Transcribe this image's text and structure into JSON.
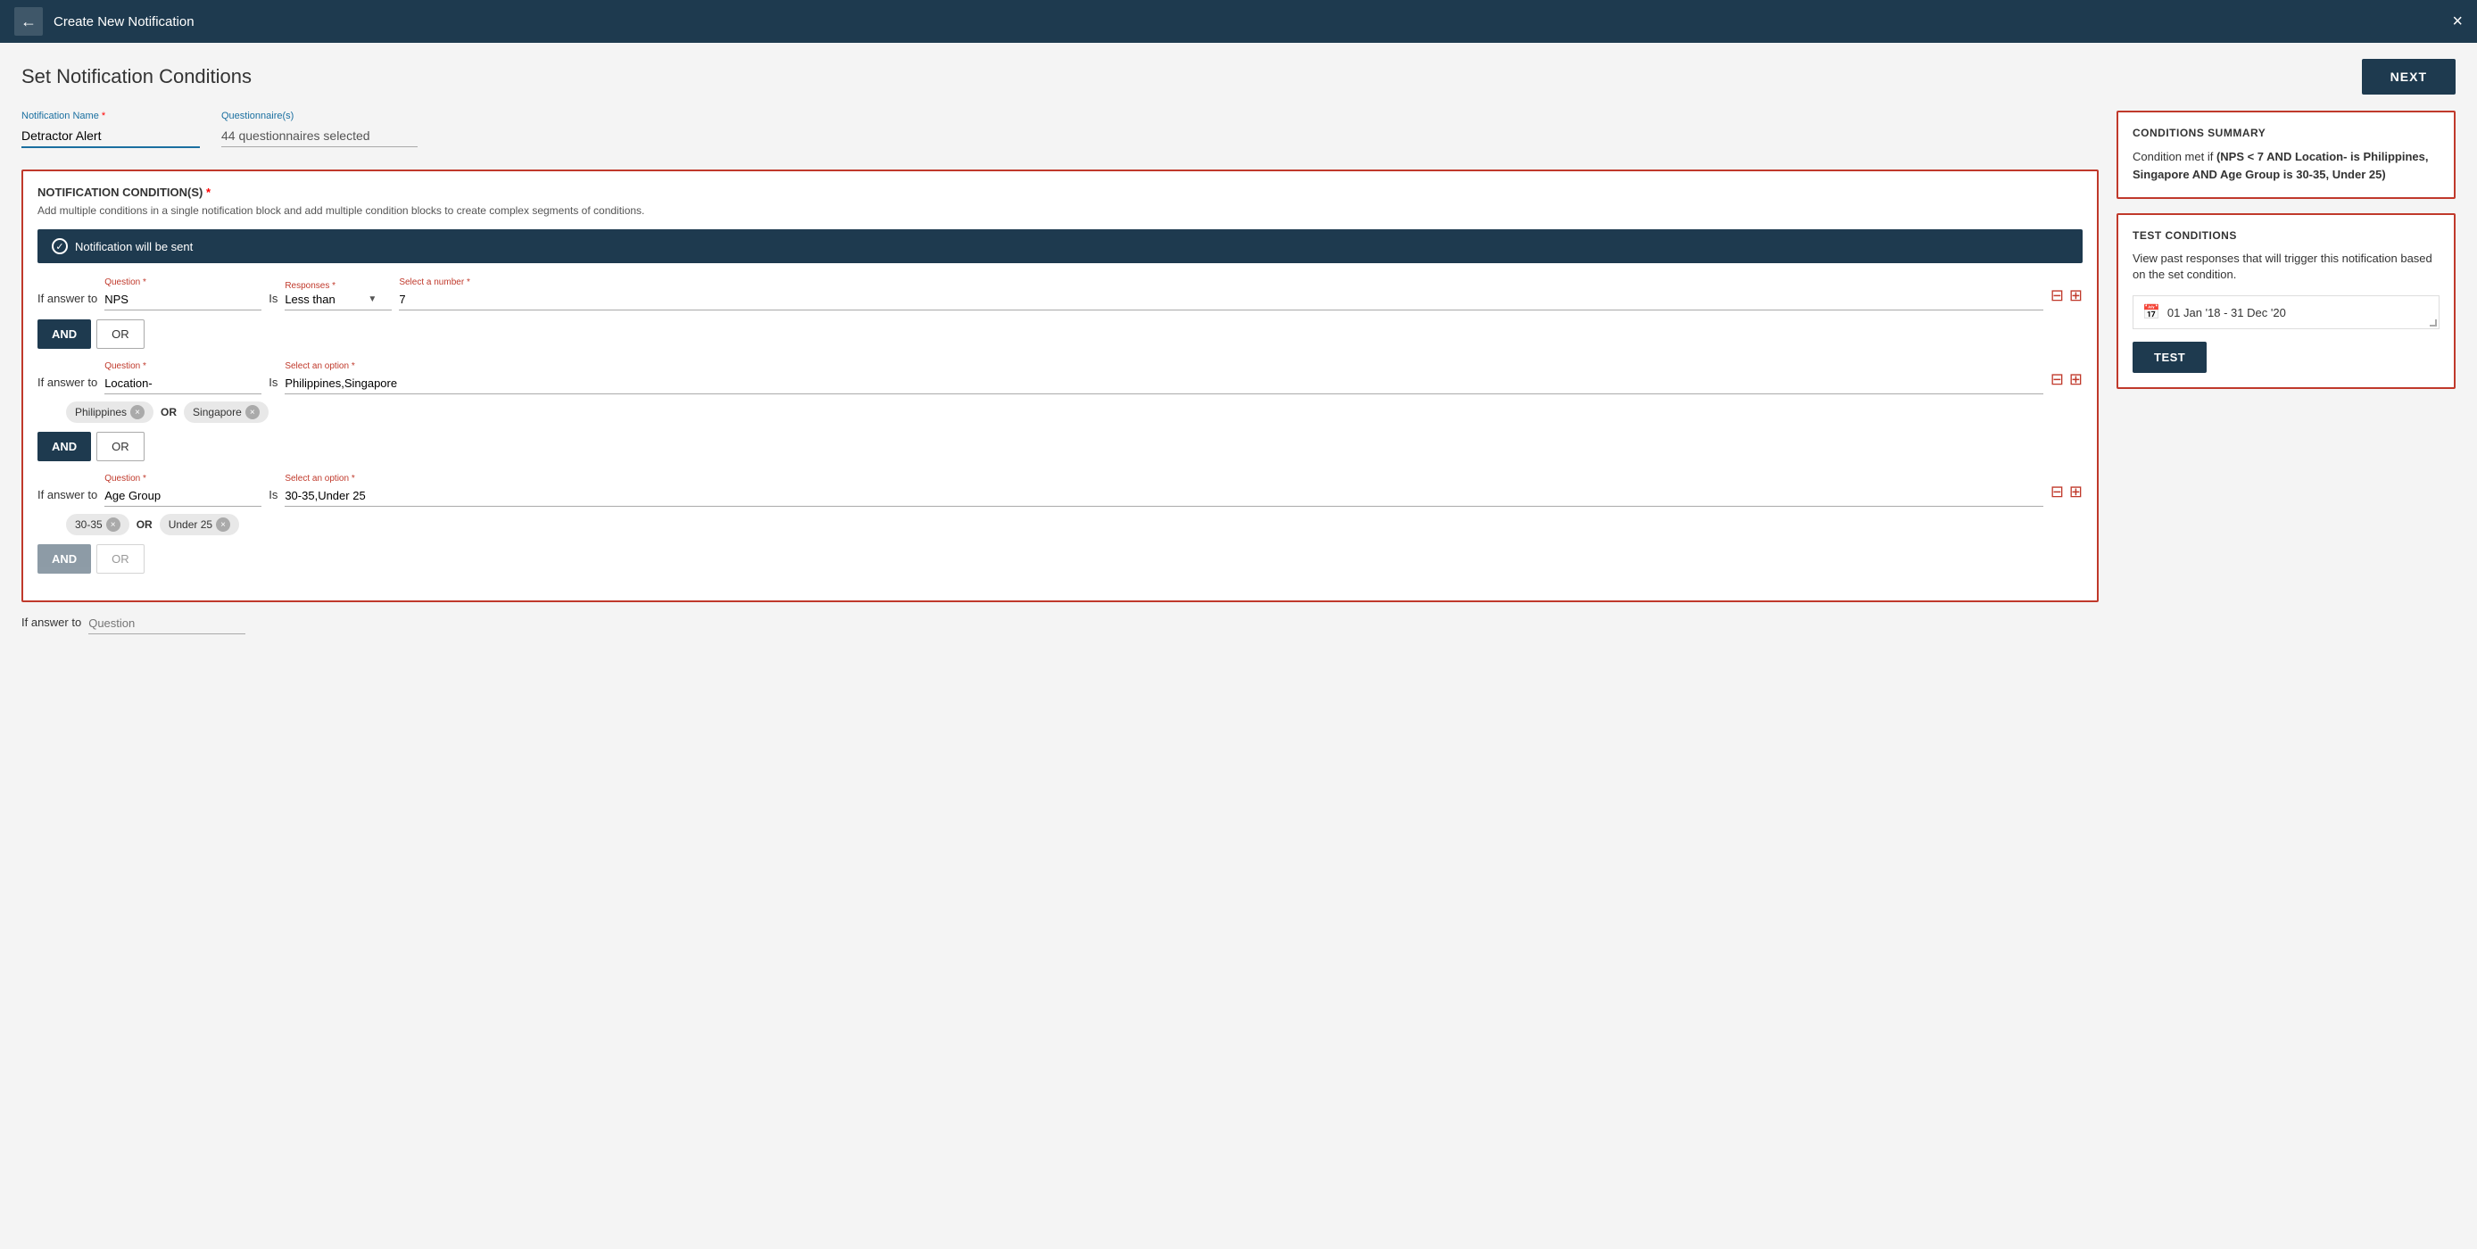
{
  "topBar": {
    "title": "Create New Notification",
    "backIcon": "←",
    "closeIcon": "×"
  },
  "pageHeader": {
    "title": "Set Notification Conditions",
    "nextButton": "NEXT"
  },
  "form": {
    "notificationName": {
      "label": "Notification Name",
      "required": true,
      "value": "Detractor Alert"
    },
    "questionnaires": {
      "label": "Questionnaire(s)",
      "value": "44 questionnaires selected"
    }
  },
  "notificationConditions": {
    "title": "NOTIFICATION CONDITION(S)",
    "required": true,
    "description": "Add multiple conditions in a single notification block and add multiple condition blocks to create complex segments of conditions.",
    "notifBar": "Notification will be sent",
    "conditions": [
      {
        "id": 1,
        "questionLabel": "Question",
        "questionValue": "NPS",
        "responsesLabel": "Responses",
        "responsesType": "less_than",
        "responsesDisplay": "Less than",
        "selectNumberLabel": "Select a number",
        "numberValue": "7",
        "inputType": "number"
      },
      {
        "id": 2,
        "questionLabel": "Question",
        "questionValue": "Location-",
        "selectOptionLabel": "Select an option",
        "optionValue": "Philippines,Singapore",
        "tags": [
          {
            "label": "Philippines"
          },
          {
            "label": "Singapore"
          }
        ],
        "inputType": "option"
      },
      {
        "id": 3,
        "questionLabel": "Question",
        "questionValue": "Age Group",
        "selectOptionLabel": "Select an option",
        "optionValue": "30-35,Under 25",
        "tags": [
          {
            "label": "30-35"
          },
          {
            "label": "Under 25"
          }
        ],
        "inputType": "option"
      }
    ],
    "andLabel": "AND",
    "orLabel": "OR",
    "bottomPlaceholder": "Question"
  },
  "conditionsSummary": {
    "title": "CONDITIONS SUMMARY",
    "conditionText": "Condition met if ",
    "conditionDetail": "(NPS < 7 AND Location- is Philippines, Singapore AND Age Group is 30-35, Under 25)"
  },
  "testConditions": {
    "title": "TEST CONDITIONS",
    "description": "View past responses that will trigger this notification based on the set condition.",
    "dateRange": "01 Jan '18 - 31 Dec '20",
    "testButton": "TEST"
  }
}
